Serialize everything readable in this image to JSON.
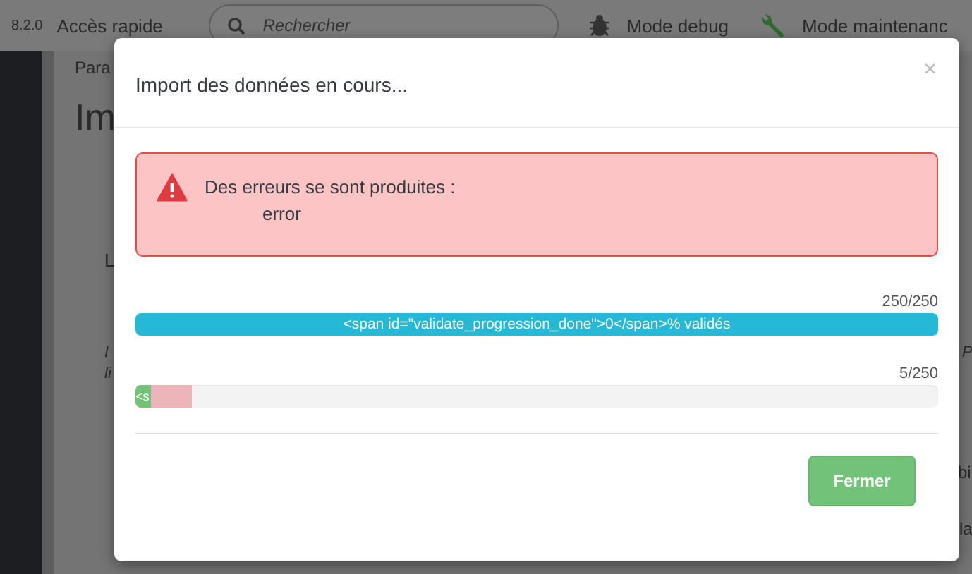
{
  "header": {
    "version": "8.2.0",
    "quick_access": "Accès rapide",
    "search": {
      "placeholder": "Rechercher"
    },
    "debug": "Mode debug",
    "maintenance": "Mode maintenanc"
  },
  "background": {
    "breadcrumb": "Para",
    "title": "Im",
    "label": "L",
    "hint_1": "I",
    "hint_2": "li",
    "right_1": "P",
    "right_2": "bi",
    "right_3": "la"
  },
  "modal": {
    "title": "Import des données en cours...",
    "close": "×",
    "alert": {
      "message": "Des erreurs se sont produites :",
      "detail": "error"
    },
    "progress": [
      {
        "count": "250/250",
        "segments": [
          {
            "kind": "info",
            "level": 1,
            "label": "<span id=\"validate_progression_done\">0</span>% validés"
          }
        ]
      },
      {
        "count": "5/250",
        "segments": [
          {
            "kind": "success",
            "level": 0.02,
            "label": "<s"
          },
          {
            "kind": "danger",
            "level": 0.07
          }
        ]
      }
    ],
    "button": "Fermer"
  }
}
